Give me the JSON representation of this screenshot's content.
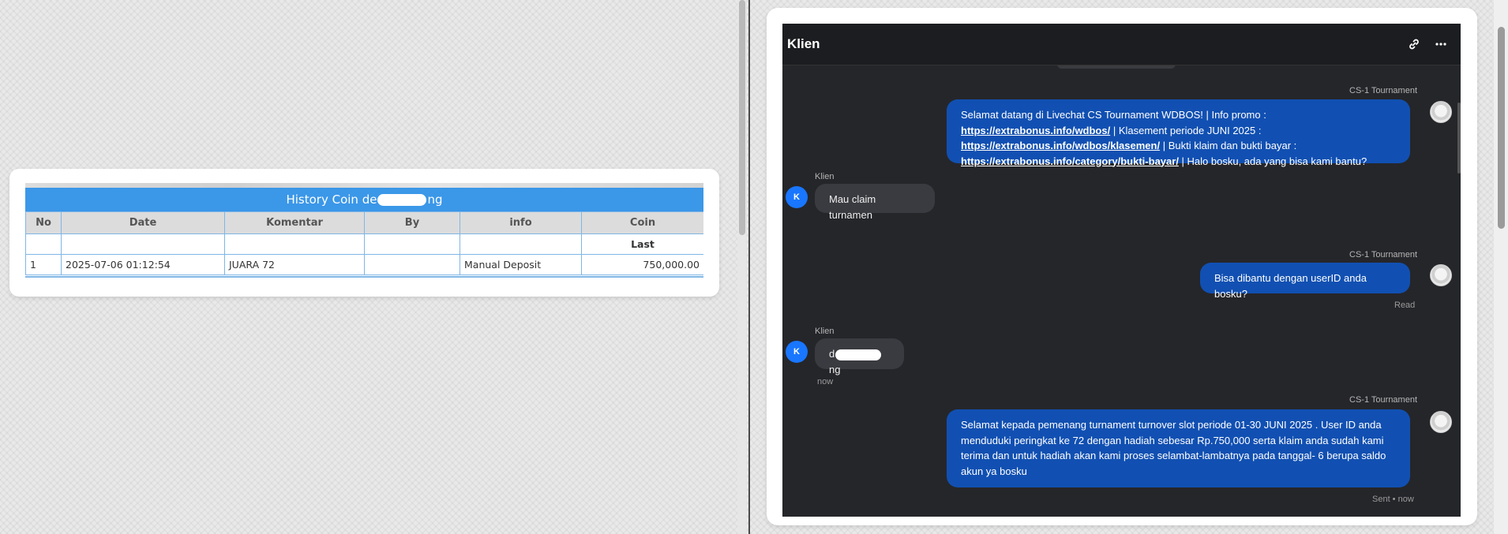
{
  "history": {
    "title_prefix": "History Coin de",
    "title_suffix": "ng",
    "columns": [
      "No",
      "Date",
      "Komentar",
      "By",
      "info",
      "Coin"
    ],
    "subheader_last": "Last",
    "rows": [
      {
        "no": "1",
        "date": "2025-07-06 01:12:54",
        "komentar": "JUARA 72",
        "by": "",
        "info": "Manual Deposit",
        "coin": "750,000.00"
      }
    ]
  },
  "chat": {
    "title": "Klien",
    "icons": {
      "link": "link-icon",
      "more": "more-icon"
    },
    "messages": [
      {
        "sender": "CS-1 Tournament",
        "text_1": "Selamat datang di Livechat CS Tournament WDBOS! | Info promo :",
        "link_1": "https://extrabonus.info/wdbos/",
        "text_2": " | Klasement periode JUNI 2025 :",
        "link_2": "https://extrabonus.info/wdbos/klasemen/",
        "text_3": " | Bukti klaim dan bukti bayar :",
        "link_3": "https://extrabonus.info/category/bukti-bayar/",
        "text_4": " | Halo bosku, ada yang bisa kami bantu?"
      },
      {
        "sender": "Klien",
        "avatar": "K",
        "text": "Mau claim turnamen"
      },
      {
        "sender": "CS-1 Tournament",
        "text": "Bisa dibantu dengan userID anda bosku?",
        "status": "Read"
      },
      {
        "sender": "Klien",
        "avatar": "K",
        "text_prefix": "d",
        "text_suffix": "ng",
        "time": "now"
      },
      {
        "sender": "CS-1 Tournament",
        "text": "Selamat kepada pemenang turnament turnover slot periode 01-30 JUNI 2025 . User ID anda menduduki peringkat ke 72 dengan hadiah sebesar Rp.750,000 serta klaim anda sudah kami terima dan untuk hadiah akan kami proses selambat-lambatnya pada tanggal- 6 berupa saldo akun ya bosku",
        "status": "Sent • now"
      }
    ]
  }
}
